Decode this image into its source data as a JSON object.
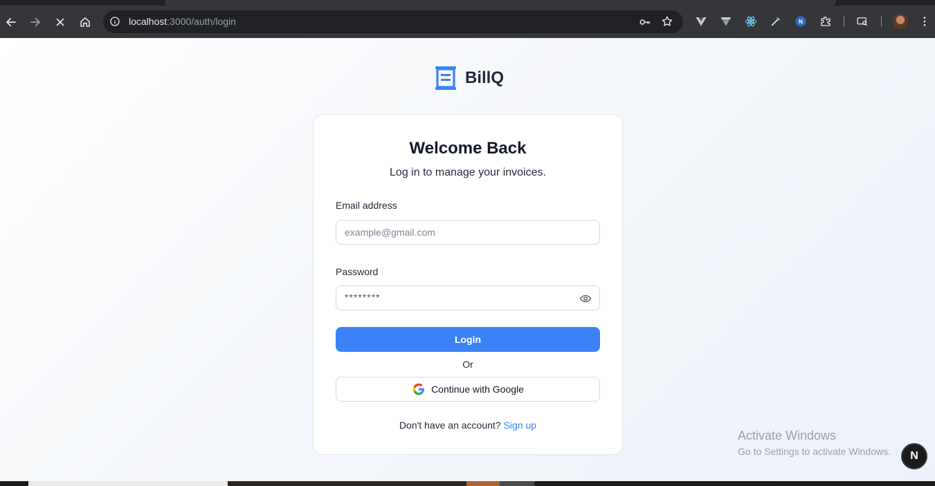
{
  "browser": {
    "url_host": "localhost",
    "url_rest": ":3000/auth/login",
    "icons": [
      "back-icon",
      "forward-icon",
      "stop-loading-icon",
      "home-icon",
      "site-info-icon",
      "password-key-icon",
      "bookmark-star-icon",
      "extensions-icon",
      "tab-search-icon",
      "menu-icon"
    ]
  },
  "brand": {
    "name": "BillQ",
    "accent": "#3b82f6"
  },
  "login": {
    "title": "Welcome Back",
    "subtitle": "Log in to manage your invoices.",
    "email_label": "Email address",
    "email_placeholder": "example@gmail.com",
    "password_label": "Password",
    "password_value": "********",
    "login_button": "Login",
    "or_text": "Or",
    "google_button": "Continue with Google",
    "signup_prompt": "Don't have an account?",
    "signup_link": "Sign up"
  },
  "overlay": {
    "activate_title": "Activate Windows",
    "activate_sub": "Go to Settings to activate Windows.",
    "badge": "N"
  }
}
